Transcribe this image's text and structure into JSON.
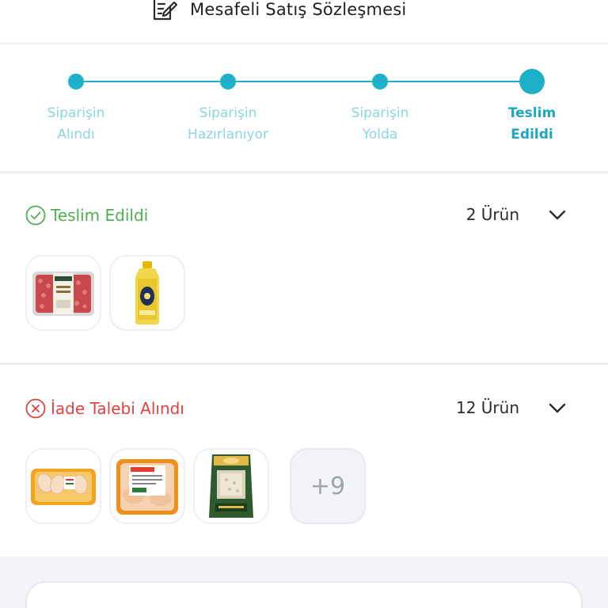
{
  "header": {
    "title": "Mesafeli Satış Sözleşmesi",
    "icon": "contract-icon"
  },
  "stepper": {
    "steps": [
      {
        "line1": "Siparişin",
        "line2": "Alındı",
        "active": false
      },
      {
        "line1": "Siparişin",
        "line2": "Hazırlanıyor",
        "active": false
      },
      {
        "line1": "Siparişin",
        "line2": "Yolda",
        "active": false
      },
      {
        "line1": "Teslim",
        "line2": "Edildi",
        "active": true
      }
    ],
    "accent_color": "#1db0c9"
  },
  "delivered": {
    "status": "Teslim Edildi",
    "status_icon": "check-circle-icon",
    "status_color": "#4caf50",
    "count": "2 Ürün",
    "products": [
      {
        "name": "minced-meat-package-icon"
      },
      {
        "name": "sunflower-oil-bottle-icon"
      }
    ]
  },
  "returned": {
    "status": "İade Talebi Alındı",
    "status_icon": "x-circle-icon",
    "status_color": "#e0433f",
    "count": "12 Ürün",
    "products": [
      {
        "name": "chicken-drumsticks-tray-icon"
      },
      {
        "name": "chicken-pieces-tray-icon"
      },
      {
        "name": "rice-bag-icon"
      }
    ],
    "more_label": "+9"
  }
}
